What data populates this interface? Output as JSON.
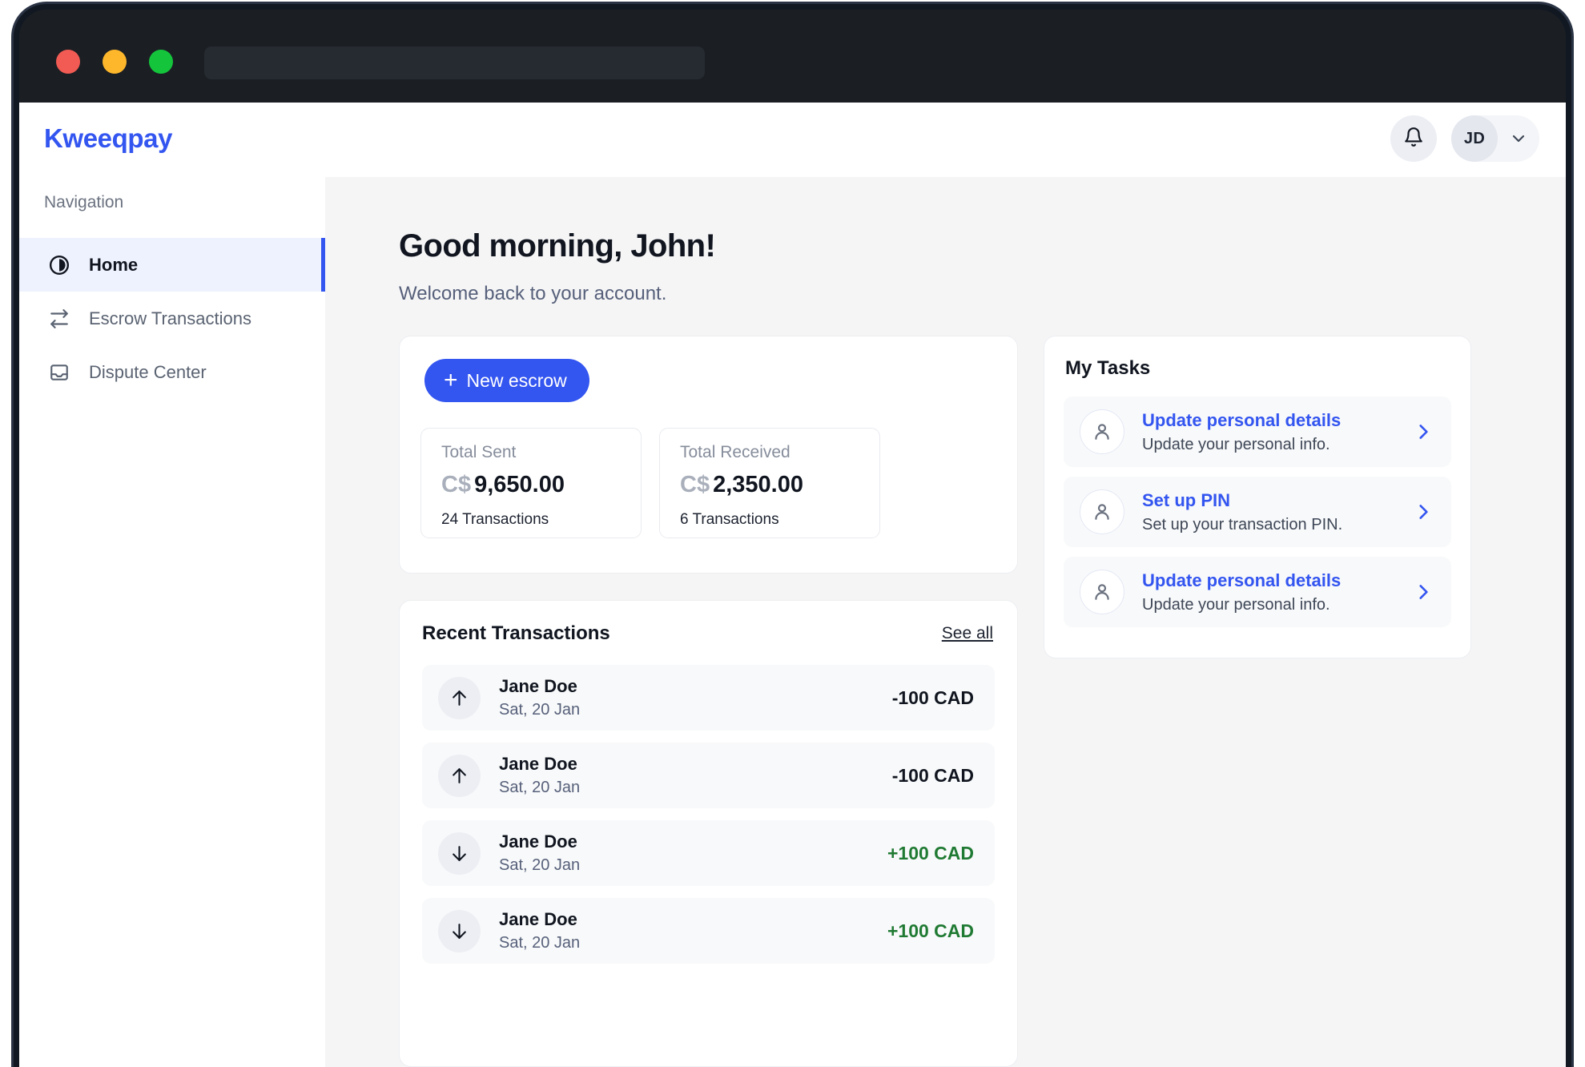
{
  "browser": {
    "url_value": "",
    "url_placeholder": "",
    "window_controls": [
      "close",
      "minimize",
      "maximize"
    ]
  },
  "header": {
    "brand": "Kweeqpay",
    "notification_icon": "bell-icon",
    "avatar_initials": "JD",
    "chevron_icon": "chevron-down-icon"
  },
  "sidebar": {
    "section_label": "Navigation",
    "items": [
      {
        "label": "Home",
        "icon": "contrast-circle-icon",
        "active": true
      },
      {
        "label": "Escrow Transactions",
        "icon": "exchange-arrows-icon",
        "active": false
      },
      {
        "label": "Dispute Center",
        "icon": "inbox-tray-icon",
        "active": false
      }
    ]
  },
  "main": {
    "greeting": "Good morning, John!",
    "subgreeting": "Welcome back to your account."
  },
  "overview": {
    "new_escrow_label": "New escrow",
    "new_escrow_icon": "plus-icon",
    "stats": [
      {
        "label": "Total Sent",
        "currency": "C$",
        "amount": "9,650.00",
        "count": "24 Transactions"
      },
      {
        "label": "Total Received",
        "currency": "C$",
        "amount": "2,350.00",
        "count": "6 Transactions"
      }
    ]
  },
  "transactions": {
    "title": "Recent Transactions",
    "see_all_label": "See all",
    "rows": [
      {
        "name": "Jane Doe",
        "date": "Sat, 20 Jan",
        "amount": "-100 CAD",
        "direction": "sent",
        "icon": "arrow-up-icon"
      },
      {
        "name": "Jane Doe",
        "date": "Sat, 20 Jan",
        "amount": "-100 CAD",
        "direction": "sent",
        "icon": "arrow-up-icon"
      },
      {
        "name": "Jane Doe",
        "date": "Sat, 20 Jan",
        "amount": "+100 CAD",
        "direction": "received",
        "icon": "arrow-down-icon"
      },
      {
        "name": "Jane Doe",
        "date": "Sat, 20 Jan",
        "amount": "+100 CAD",
        "direction": "received",
        "icon": "arrow-down-icon"
      }
    ]
  },
  "tasks": {
    "title": "My Tasks",
    "items": [
      {
        "title": "Update personal details",
        "desc": "Update your personal info.",
        "icon": "user-icon",
        "chevron": "chevron-right-icon"
      },
      {
        "title": "Set up PIN",
        "desc": "Set up your transaction PIN.",
        "icon": "user-icon",
        "chevron": "chevron-right-icon"
      },
      {
        "title": "Update personal details",
        "desc": "Update your personal info.",
        "icon": "user-icon",
        "chevron": "chevron-right-icon"
      }
    ]
  },
  "colors": {
    "brand_blue": "#3355f0",
    "active_nav_bg": "#eef2fe",
    "credit_green": "#1f7a33",
    "page_bg": "#f5f5f6",
    "chrome_dark": "#1b1f24"
  }
}
